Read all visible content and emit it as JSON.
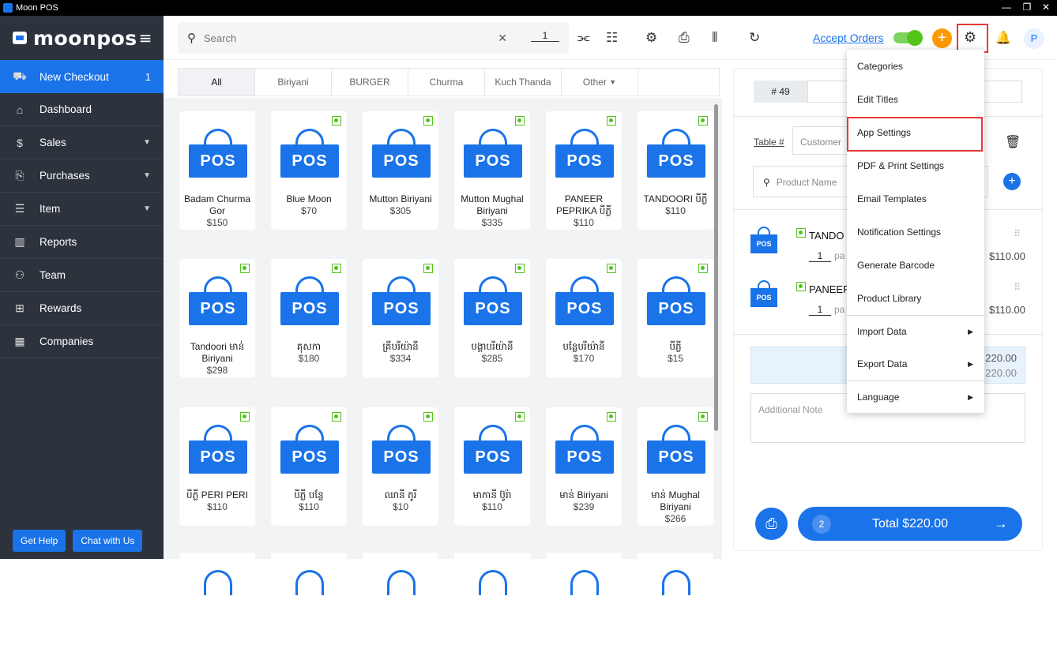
{
  "window": {
    "title": "Moon POS",
    "minimize": "—",
    "maximize": "❐",
    "close": "✕"
  },
  "sidebar": {
    "brand": "moonpos",
    "items": [
      {
        "label": "New Checkout",
        "count": "1",
        "icon": "basket-icon"
      },
      {
        "label": "Dashboard",
        "icon": "home-icon"
      },
      {
        "label": "Sales",
        "icon": "dollar-doc-icon"
      },
      {
        "label": "Purchases",
        "icon": "purchase-doc-icon"
      },
      {
        "label": "Item",
        "icon": "list-icon"
      },
      {
        "label": "Reports",
        "icon": "chart-icon"
      },
      {
        "label": "Team",
        "icon": "team-icon"
      },
      {
        "label": "Rewards",
        "icon": "gift-icon"
      },
      {
        "label": "Companies",
        "icon": "building-icon"
      }
    ],
    "help_label": "Get Help",
    "chat_label": "Chat with Us"
  },
  "topbar": {
    "search_placeholder": "Search",
    "qty": "1",
    "accept_orders": "Accept Orders",
    "avatar": "P"
  },
  "categories": [
    "All",
    "Biriyani",
    "BURGER",
    "Churma",
    "Kuch Thanda",
    "Other"
  ],
  "products": [
    {
      "name": "Badam Churma Gor",
      "price": "$150",
      "veg": false
    },
    {
      "name": "Blue Moon",
      "price": "$70",
      "veg": true
    },
    {
      "name": "Mutton Biriyani",
      "price": "$305",
      "veg": true
    },
    {
      "name": "Mutton Mughal Biriyani",
      "price": "$335",
      "veg": true
    },
    {
      "name": "PANEER PEPRIKA បីភ្លី",
      "price": "$110",
      "veg": true
    },
    {
      "name": "TANDOORI បីភ្លី",
      "price": "$110",
      "veg": true
    },
    {
      "name": "Tandoori មាន់ Biriyani",
      "price": "$298",
      "veg": true
    },
    {
      "name": "គុសកា",
      "price": "$180",
      "veg": true
    },
    {
      "name": "គ្រីបរីយ៉ានី",
      "price": "$334",
      "veg": true
    },
    {
      "name": "បង្គាបរីយ៉ានី",
      "price": "$285",
      "veg": true
    },
    {
      "name": "បន្លែបរីយ៉ានី",
      "price": "$170",
      "veg": true
    },
    {
      "name": "បីភ្លី",
      "price": "$15",
      "veg": true
    },
    {
      "name": "បីភ្លី PERI PERI",
      "price": "$110",
      "veg": true
    },
    {
      "name": "បីភ្លី បន្លែ",
      "price": "$110",
      "veg": true
    },
    {
      "name": "ឈានី ភូរី",
      "price": "$10",
      "veg": true
    },
    {
      "name": "មាកានី ប៊ូរ៉ា",
      "price": "$110",
      "veg": true
    },
    {
      "name": "មាន់ Biriyani",
      "price": "$239",
      "veg": true
    },
    {
      "name": "មាន់ Mughal Biriyani",
      "price": "$266",
      "veg": true
    }
  ],
  "bag_label": "POS",
  "order": {
    "number": "# 49",
    "table_label": "Table #",
    "customer_placeholder": "Customer",
    "product_placeholder": "Product Name",
    "lines": [
      {
        "name": "TANDO",
        "qty": "1",
        "unit": "pa",
        "price": "$110.00"
      },
      {
        "name": "PANEER",
        "qty": "1",
        "unit": "pa",
        "price": "$110.00"
      }
    ],
    "subtotal": "220.00",
    "total_small": "220.00",
    "note_placeholder": "Additional Note",
    "count": "2",
    "total_label": "Total $220.00"
  },
  "settings_menu": [
    {
      "label": "Categories"
    },
    {
      "label": "Edit Titles"
    },
    {
      "label": "App Settings"
    },
    {
      "label": "PDF & Print Settings"
    },
    {
      "label": "Email Templates"
    },
    {
      "label": "Notification Settings"
    },
    {
      "label": "Generate Barcode"
    },
    {
      "label": "Product Library"
    },
    {
      "label": "Import Data",
      "submenu": true
    },
    {
      "label": "Export Data",
      "submenu": true
    },
    {
      "label": "Language",
      "submenu": true
    }
  ],
  "colors": {
    "accent": "#1a73e8",
    "sidebar": "#2d333d",
    "highlight": "#e53935",
    "veg": "#52c41a",
    "orange": "#ff9800"
  }
}
